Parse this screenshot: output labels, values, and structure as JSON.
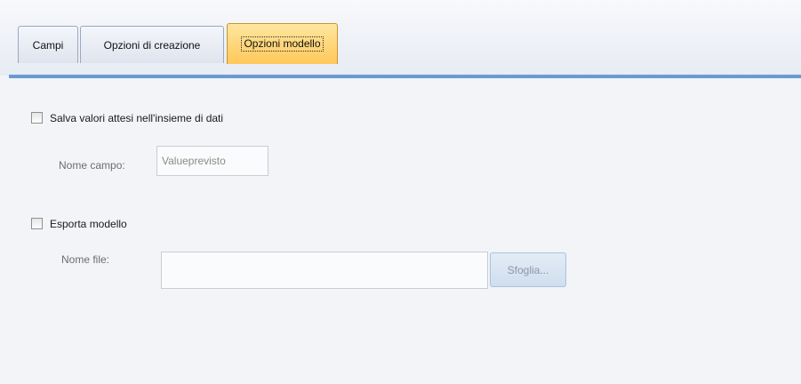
{
  "tabs": [
    {
      "label": "Campi",
      "active": false
    },
    {
      "label": "Opzioni di creazione",
      "active": false
    },
    {
      "label": "Opzioni modello",
      "active": true
    }
  ],
  "save_predicted": {
    "label": "Salva valori attesi nell'insieme di dati",
    "checked": false,
    "field_name_label": "Nome campo:",
    "field_name_value": "Valueprevisto"
  },
  "export_model": {
    "label": "Esporta modello",
    "checked": false,
    "file_name_label": "Nome file:",
    "file_name_value": "",
    "browse_label": "Sfoglia..."
  },
  "colors": {
    "active_tab": "#ffc85a",
    "tab_underline": "#6a9bd0"
  }
}
